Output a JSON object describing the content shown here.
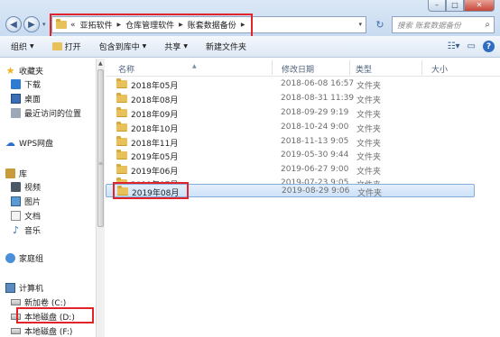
{
  "window": {
    "controls": {
      "minimize": "–",
      "maximize": "□",
      "close": "✕"
    }
  },
  "nav": {
    "back": "◀",
    "forward": "▶",
    "history": "▾"
  },
  "address": {
    "prefix": "«",
    "crumbs": [
      "亚拓软件",
      "仓库管理软件",
      "账套数据备份"
    ],
    "separator": "▶"
  },
  "refresh": "↻",
  "search": {
    "placeholder": "搜索 账套数据备份",
    "icon": "search-icon"
  },
  "toolbar": {
    "organize": "组织",
    "open": "打开",
    "include": "包含到库中",
    "share": "共享",
    "new_folder": "新建文件夹"
  },
  "sidebar": {
    "favorites": "收藏夹",
    "downloads": "下载",
    "desktop": "桌面",
    "recent": "最近访问的位置",
    "wps": "WPS网盘",
    "libraries": "库",
    "video": "视频",
    "pictures": "图片",
    "documents": "文档",
    "music": "音乐",
    "homegroup": "家庭组",
    "computer": "计算机",
    "drive_c": "新加卷 (C:)",
    "drive_d": "本地磁盘 (D:)",
    "drive_f": "本地磁盘 (F:)"
  },
  "columns": {
    "name": "名称",
    "date": "修改日期",
    "type": "类型",
    "size": "大小"
  },
  "files": [
    {
      "name": "2018年05月",
      "date": "2018-06-08 16:57",
      "type": "文件夹"
    },
    {
      "name": "2018年08月",
      "date": "2018-08-31 11:39",
      "type": "文件夹"
    },
    {
      "name": "2018年09月",
      "date": "2018-09-29 9:19",
      "type": "文件夹"
    },
    {
      "name": "2018年10月",
      "date": "2018-10-24 9:00",
      "type": "文件夹"
    },
    {
      "name": "2018年11月",
      "date": "2018-11-13 9:05",
      "type": "文件夹"
    },
    {
      "name": "2019年05月",
      "date": "2019-05-30 9:44",
      "type": "文件夹"
    },
    {
      "name": "2019年06月",
      "date": "2019-06-27 9:00",
      "type": "文件夹"
    },
    {
      "name": "2019年07月",
      "date": "2019-07-23 9:05",
      "type": "文件夹"
    },
    {
      "name": "2019年08月",
      "date": "2019-08-29 9:06",
      "type": "文件夹"
    }
  ],
  "colors": {
    "highlight": "#e0242a",
    "selection": "#cde2f8",
    "folder": "#e9c15a"
  }
}
